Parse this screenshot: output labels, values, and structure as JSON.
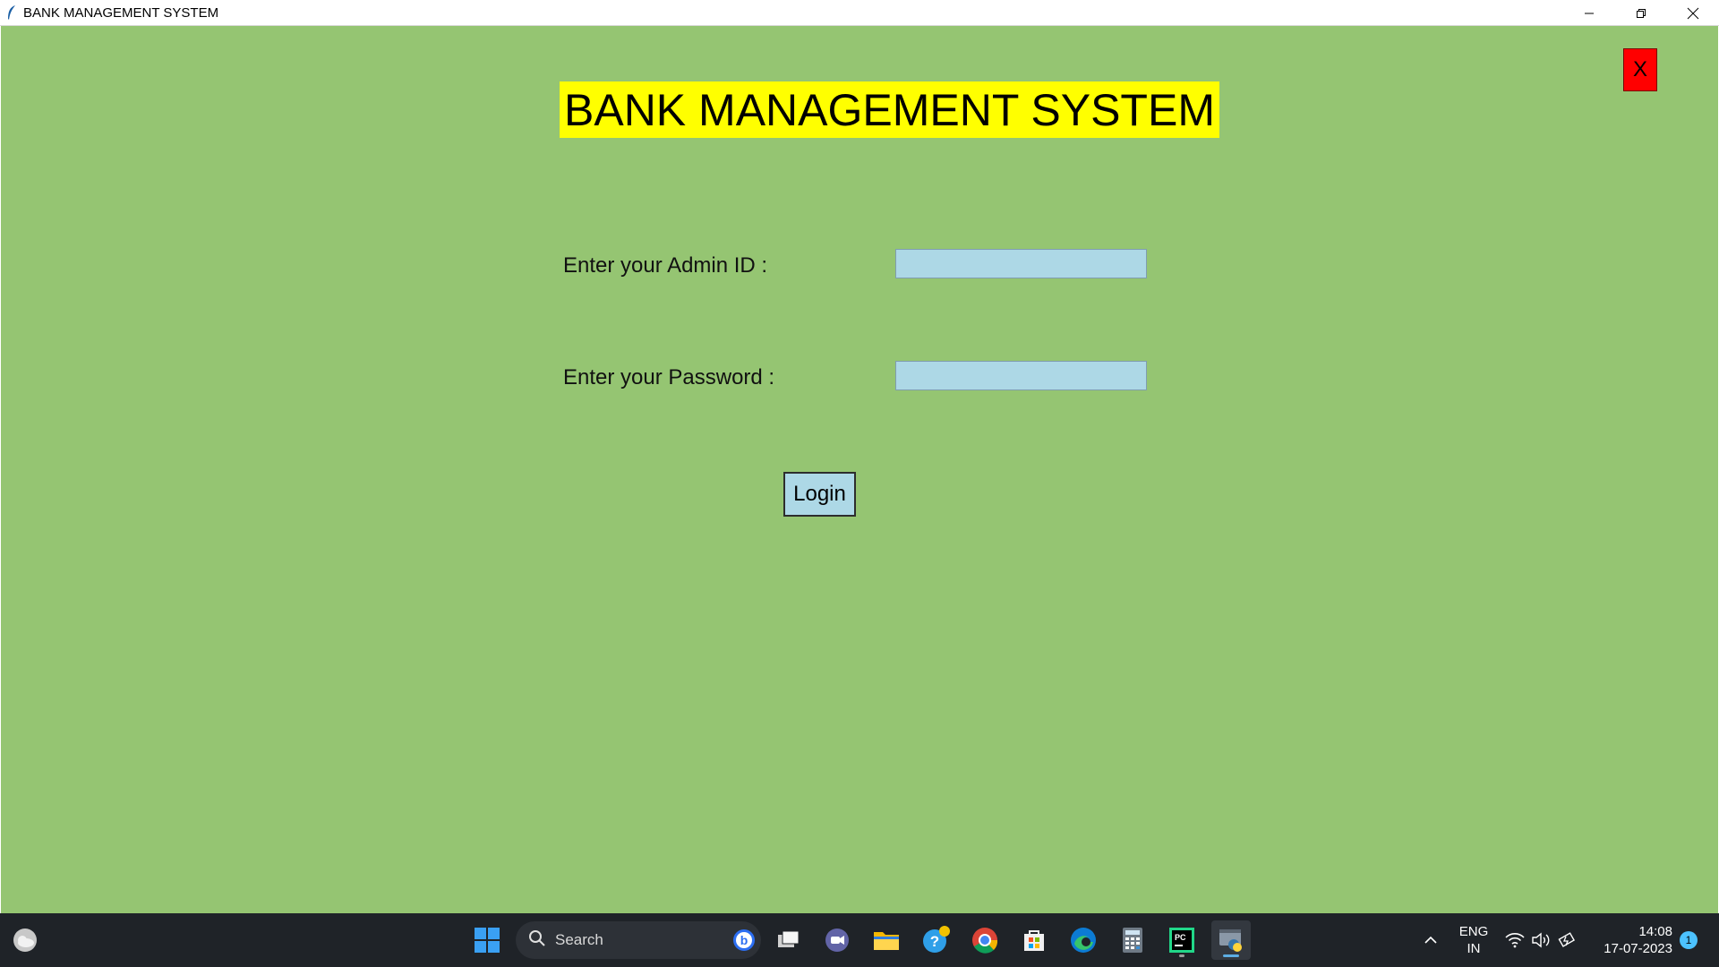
{
  "window": {
    "title": "BANK MANAGEMENT SYSTEM"
  },
  "app": {
    "close_label": "X",
    "heading": "BANK MANAGEMENT SYSTEM",
    "admin_label": "Enter your Admin ID :",
    "admin_value": "",
    "password_label": "Enter your Password :",
    "password_value": "",
    "login_label": "Login",
    "colors": {
      "background": "#95c572",
      "heading_bg": "#ffff00",
      "entry_bg": "#add8e6",
      "close_bg": "#ff0000"
    }
  },
  "taskbar": {
    "search_placeholder": "Search",
    "icons": [
      "weather-icon",
      "windows-start-icon",
      "bing-icon",
      "task-view-icon",
      "teams-icon",
      "file-explorer-icon",
      "help-icon",
      "chrome-icon",
      "store-icon",
      "edge-icon",
      "calculator-icon",
      "pycharm-icon",
      "python-icon"
    ],
    "lang_line1": "ENG",
    "lang_line2": "IN",
    "time": "14:08",
    "date": "17-07-2023",
    "notification_count": "1"
  }
}
